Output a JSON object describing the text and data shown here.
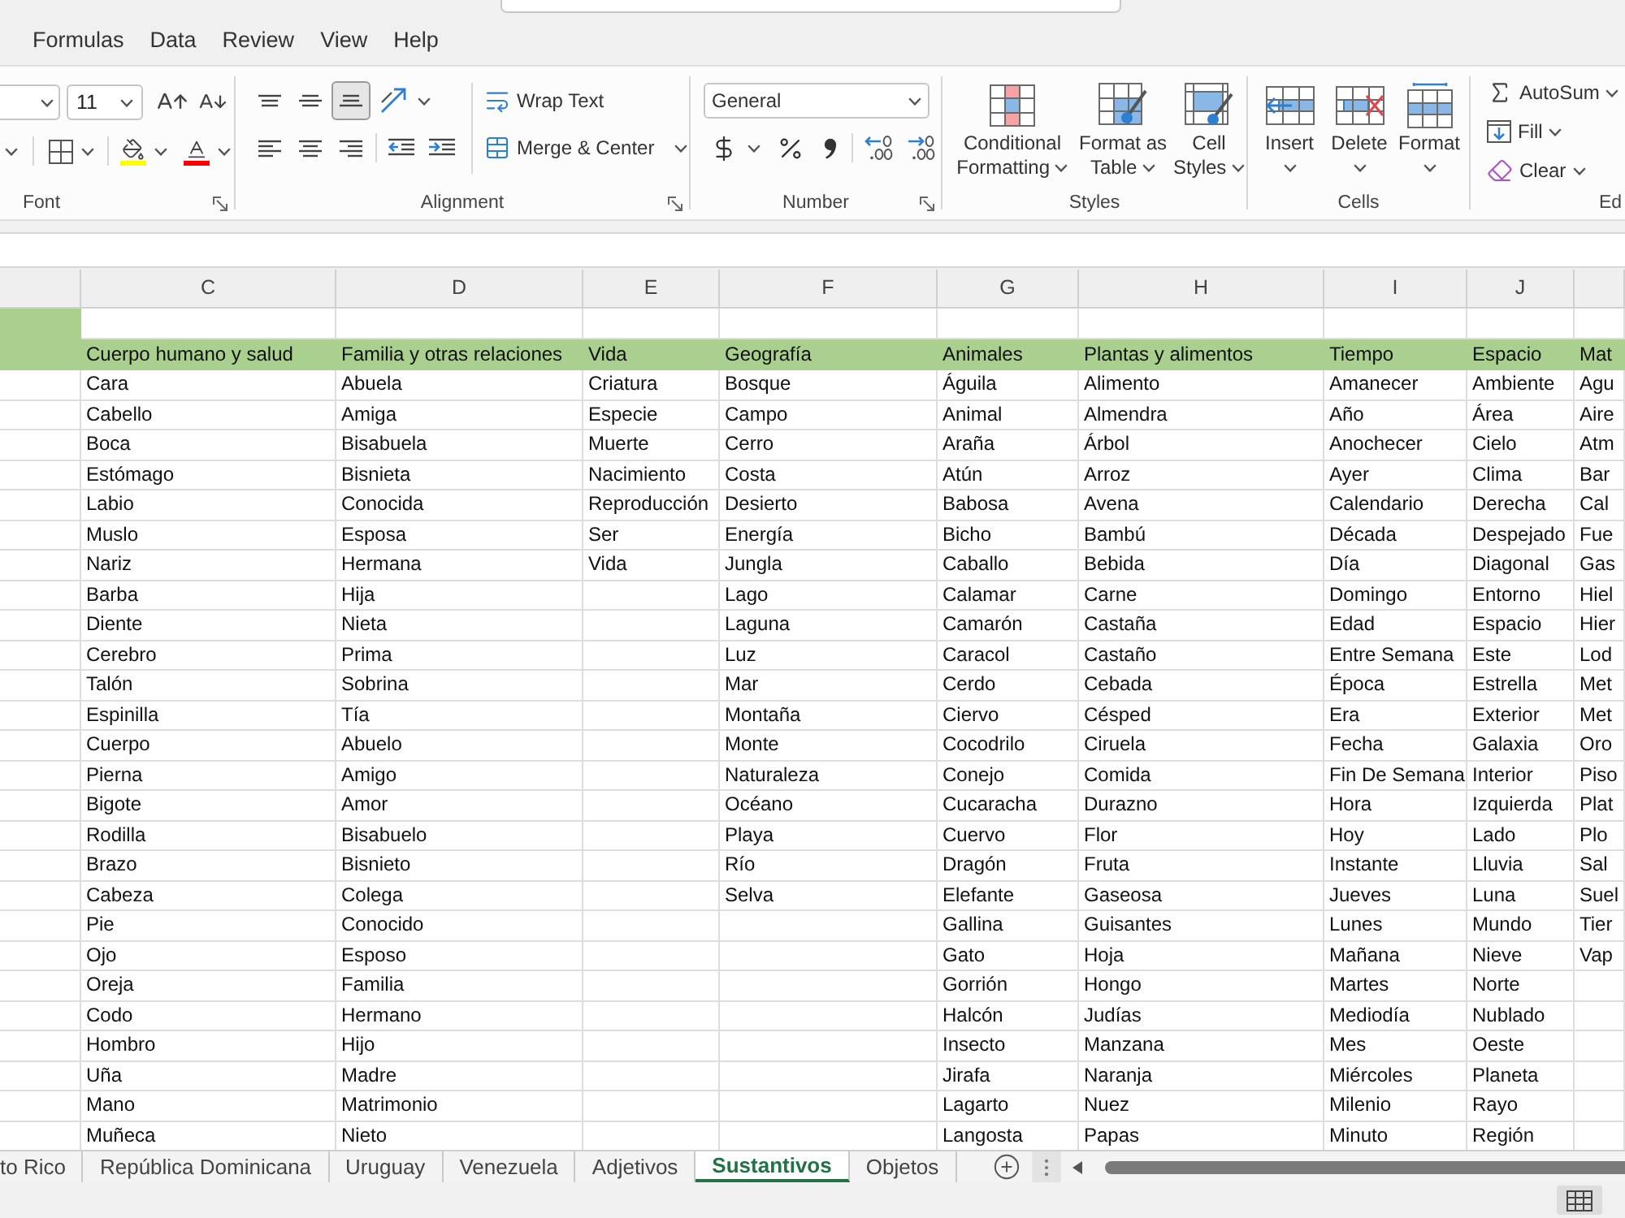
{
  "menu_tabs": [
    "Formulas",
    "Data",
    "Review",
    "View",
    "Help"
  ],
  "ribbon": {
    "font": {
      "size": "11",
      "label": "Font"
    },
    "alignment": {
      "vertical": [
        {
          "selected": false
        },
        {
          "selected": false
        },
        {
          "selected": true
        }
      ],
      "wrap_text": "Wrap Text",
      "merge": "Merge & Center",
      "label": "Alignment"
    },
    "number": {
      "format": "General",
      "label": "Number"
    },
    "styles": {
      "buttons": [
        "Conditional Formatting",
        "Format as Table",
        "Cell Styles"
      ],
      "label": "Styles"
    },
    "cells": {
      "buttons": [
        "Insert",
        "Delete",
        "Format"
      ],
      "label": "Cells"
    },
    "editing": {
      "buttons": [
        "AutoSum",
        "Fill",
        "Clear"
      ],
      "label": "Ed"
    }
  },
  "sheet": {
    "columns": [
      {
        "letter": "C",
        "title": "Cuerpo humano y salud",
        "cells": [
          "Cara",
          "Cabello",
          "Boca",
          "Estómago",
          "Labio",
          "Muslo",
          "Nariz",
          "Barba",
          "Diente",
          "Cerebro",
          "Talón",
          "Espinilla",
          "Cuerpo",
          "Pierna",
          "Bigote",
          "Rodilla",
          "Brazo",
          "Cabeza",
          "Pie",
          "Ojo",
          "Oreja",
          "Codo",
          "Hombro",
          "Uña",
          "Mano",
          "Muñeca"
        ]
      },
      {
        "letter": "D",
        "title": "Familia y otras relaciones",
        "cells": [
          "Abuela",
          "Amiga",
          "Bisabuela",
          "Bisnieta",
          "Conocida",
          "Esposa",
          "Hermana",
          "Hija",
          "Nieta",
          "Prima",
          "Sobrina",
          "Tía",
          "Abuelo",
          "Amigo",
          "Amor",
          "Bisabuelo",
          "Bisnieto",
          "Colega",
          "Conocido",
          "Esposo",
          "Familia",
          "Hermano",
          "Hijo",
          "Madre",
          "Matrimonio",
          "Nieto"
        ]
      },
      {
        "letter": "E",
        "title": "Vida",
        "cells": [
          "Criatura",
          "Especie",
          "Muerte",
          "Nacimiento",
          "Reproducción",
          "Ser",
          "Vida"
        ]
      },
      {
        "letter": "F",
        "title": "Geografía",
        "cells": [
          "Bosque",
          "Campo",
          "Cerro",
          "Costa",
          "Desierto",
          "Energía",
          "Jungla",
          "Lago",
          "Laguna",
          "Luz",
          "Mar",
          "Montaña",
          "Monte",
          "Naturaleza",
          "Océano",
          "Playa",
          "Río",
          "Selva"
        ]
      },
      {
        "letter": "G",
        "title": "Animales",
        "cells": [
          "Águila",
          "Animal",
          "Araña",
          "Atún",
          "Babosa",
          "Bicho",
          "Caballo",
          "Calamar",
          "Camarón",
          "Caracol",
          "Cerdo",
          "Ciervo",
          "Cocodrilo",
          "Conejo",
          "Cucaracha",
          "Cuervo",
          "Dragón",
          "Elefante",
          "Gallina",
          "Gato",
          "Gorrión",
          "Halcón",
          "Insecto",
          "Jirafa",
          "Lagarto",
          "Langosta"
        ]
      },
      {
        "letter": "H",
        "title": "Plantas y alimentos",
        "cells": [
          "Alimento",
          "Almendra",
          "Árbol",
          "Arroz",
          "Avena",
          "Bambú",
          "Bebida",
          "Carne",
          "Castaña",
          "Castaño",
          "Cebada",
          "Césped",
          "Ciruela",
          "Comida",
          "Durazno",
          "Flor",
          "Fruta",
          "Gaseosa",
          "Guisantes",
          "Hoja",
          "Hongo",
          "Judías",
          "Manzana",
          "Naranja",
          "Nuez",
          "Papas"
        ]
      },
      {
        "letter": "I",
        "title": "Tiempo",
        "cells": [
          "Amanecer",
          "Año",
          "Anochecer",
          "Ayer",
          "Calendario",
          "Década",
          "Día",
          "Domingo",
          "Edad",
          "Entre Semana",
          "Época",
          "Era",
          "Fecha",
          "Fin De Semana",
          "Hora",
          "Hoy",
          "Instante",
          "Jueves",
          "Lunes",
          "Mañana",
          "Martes",
          "Mediodía",
          "Mes",
          "Miércoles",
          "Milenio",
          "Minuto"
        ]
      },
      {
        "letter": "J",
        "title": "Espacio",
        "cells": [
          "Ambiente",
          "Área",
          "Cielo",
          "Clima",
          "Derecha",
          "Despejado",
          "Diagonal",
          "Entorno",
          "Espacio",
          "Este",
          "Estrella",
          "Exterior",
          "Galaxia",
          "Interior",
          "Izquierda",
          "Lado",
          "Lluvia",
          "Luna",
          "Mundo",
          "Nieve",
          "Norte",
          "Nublado",
          "Oeste",
          "Planeta",
          "Rayo",
          "Región"
        ]
      },
      {
        "title": "Mat",
        "cells": [
          "Agu",
          "Aire",
          "Atm",
          "Bar",
          "Cal",
          "Fue",
          "Gas",
          "Hiel",
          "Hier",
          "Lod",
          "Met",
          "Met",
          "Oro",
          "Piso",
          "Plat",
          "Plo",
          "Sal",
          "Suel",
          "Tier",
          "Vap"
        ]
      }
    ]
  },
  "sheet_tabs": [
    {
      "label": "to Rico",
      "selected": false
    },
    {
      "label": "República Dominicana",
      "selected": false
    },
    {
      "label": "Uruguay",
      "selected": false
    },
    {
      "label": "Venezuela",
      "selected": false
    },
    {
      "label": "Adjetivos",
      "selected": false
    },
    {
      "label": "Sustantivos",
      "selected": true
    },
    {
      "label": "Objetos",
      "selected": false
    }
  ],
  "status_bar": {
    "normal_view": {
      "selected": true
    }
  }
}
